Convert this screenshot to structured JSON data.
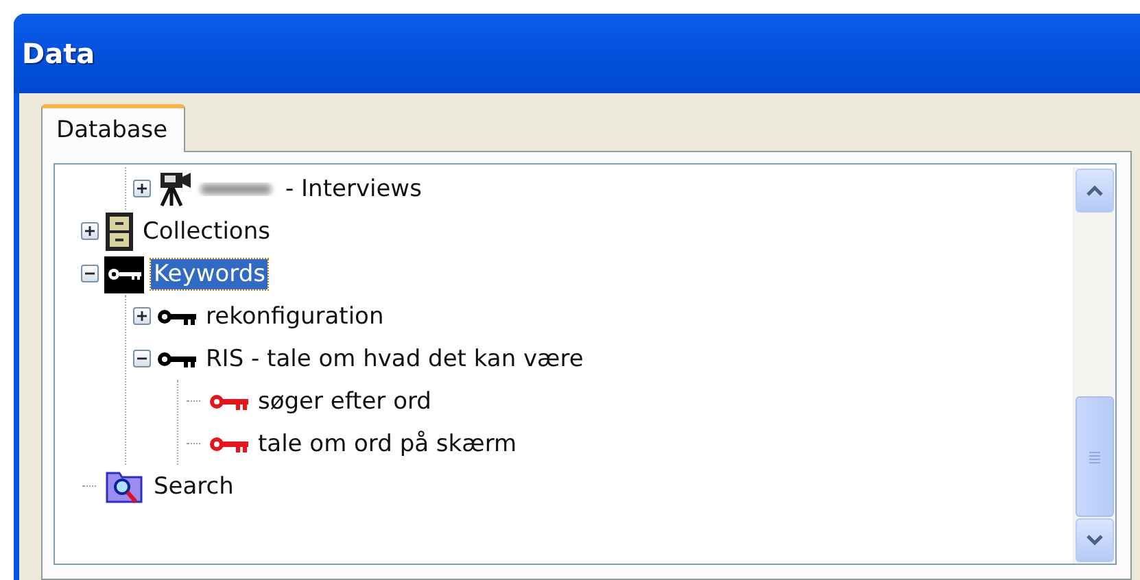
{
  "window": {
    "title": "Data"
  },
  "tabs": [
    {
      "label": "Database",
      "selected": true
    }
  ],
  "tree": [
    {
      "children": [
        {
          "label": "- Interviews",
          "kind": "camera",
          "redacted": true,
          "expanded": false
        }
      ]
    },
    {
      "label": "Collections",
      "kind": "cabinet",
      "expanded": false,
      "selected": false
    },
    {
      "label": "Keywords",
      "kind": "keys",
      "expanded": true,
      "selected": true,
      "children": [
        {
          "label": "rekonfiguration",
          "kind": "key",
          "expanded": false,
          "selected": false
        },
        {
          "label": "RIS - tale om hvad det kan være",
          "kind": "key",
          "expanded": true,
          "selected": false,
          "children": [
            {
              "label": "søger efter ord",
              "kind": "redkey",
              "selected": false
            },
            {
              "label": "tale om ord på skærm",
              "kind": "redkey",
              "selected": false
            }
          ]
        }
      ]
    },
    {
      "label": "Search",
      "kind": "search",
      "selected": false
    }
  ]
}
